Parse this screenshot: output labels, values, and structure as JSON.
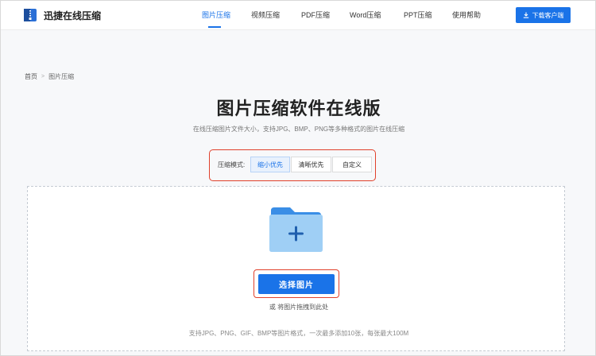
{
  "header": {
    "logo_text": "迅捷在线压缩",
    "nav": [
      {
        "label": "图片压缩",
        "active": true
      },
      {
        "label": "视频压缩",
        "active": false
      },
      {
        "label": "PDF压缩",
        "active": false
      },
      {
        "label": "Word压缩",
        "active": false
      },
      {
        "label": "PPT压缩",
        "active": false
      },
      {
        "label": "使用帮助",
        "active": false
      }
    ],
    "download_label": "下载客户端"
  },
  "breadcrumb": {
    "home": "首页",
    "separator": ">",
    "current": "图片压缩"
  },
  "page": {
    "title": "图片压缩软件在线版",
    "subtitle": "在线压缩图片文件大小，支持JPG、BMP、PNG等多种格式的图片在线压缩"
  },
  "mode": {
    "label": "压缩模式:",
    "options": [
      {
        "label": "缩小优先",
        "selected": true
      },
      {
        "label": "清晰优先",
        "selected": false
      },
      {
        "label": "自定义",
        "selected": false
      }
    ]
  },
  "upload": {
    "select_label": "选择图片",
    "drag_hint": "或 将图片拖拽到此处",
    "format_hint": "支持JPG、PNG、GIF、BMP等图片格式，一次最多添加10张，每张最大100M"
  },
  "colors": {
    "accent": "#1a73e8",
    "highlight_border": "#e0402b",
    "folder_light": "#9fcff5",
    "folder_dark": "#3a8ee6"
  },
  "icons": [
    "logo-icon",
    "download-icon",
    "folder-add-icon"
  ]
}
